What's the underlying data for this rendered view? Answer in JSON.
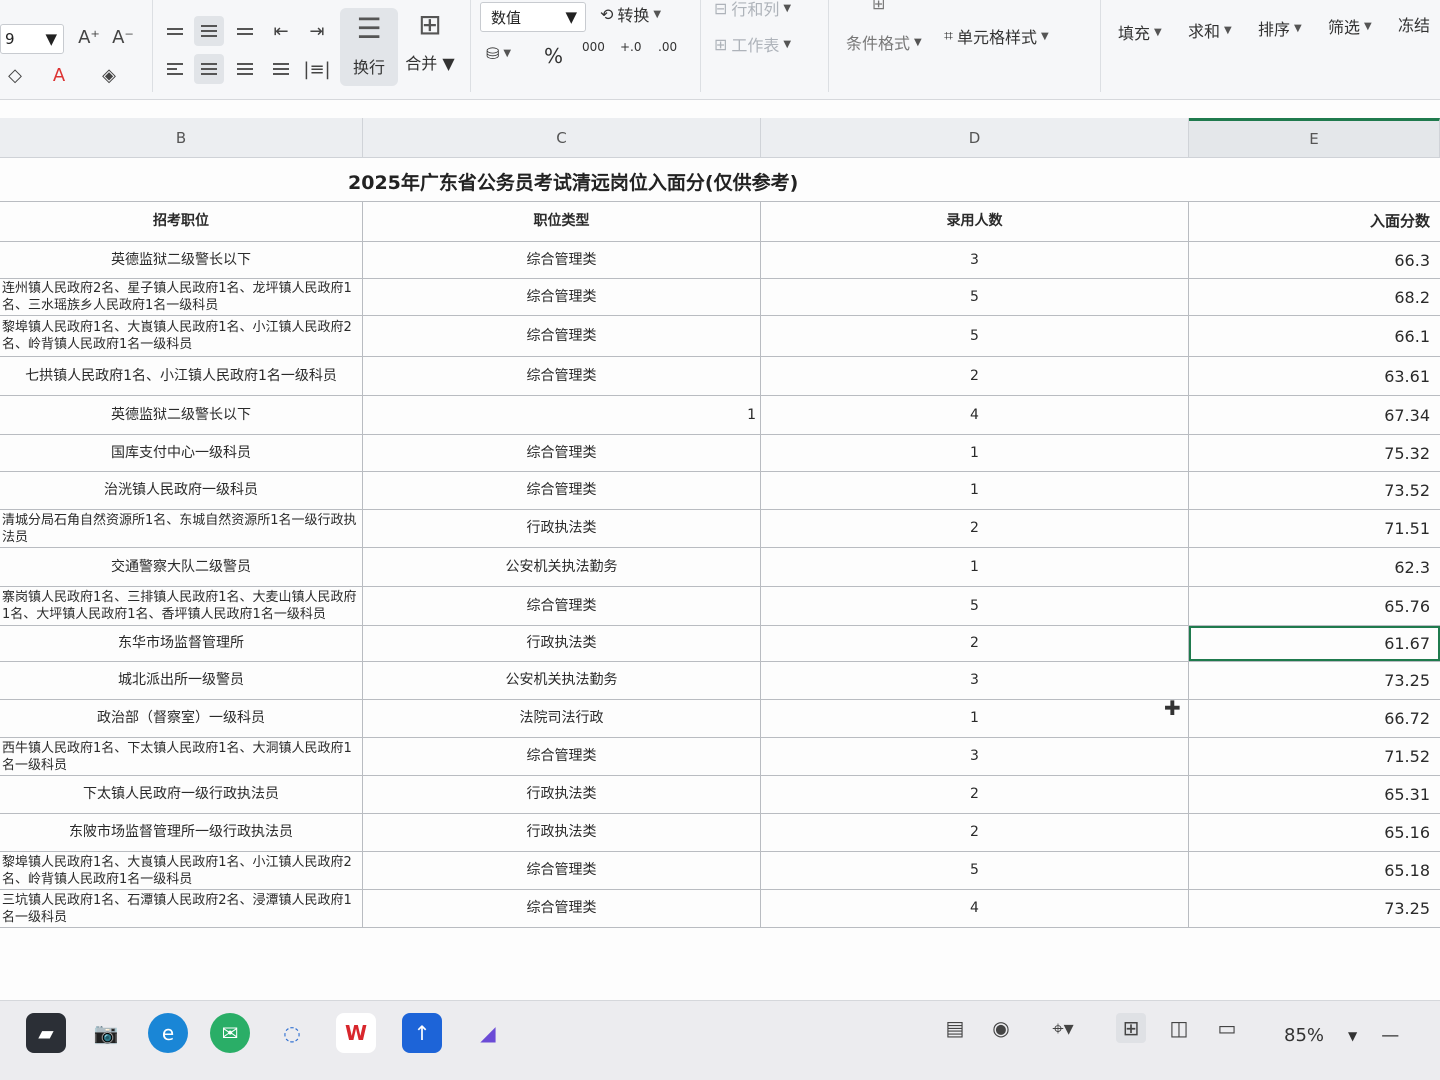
{
  "ribbon": {
    "font_size_value": "9",
    "number_format_value": "数值",
    "convert_label": "转换",
    "wrap_label": "换行",
    "merge_label": "合并",
    "row_col_label": "行和列",
    "worksheet_label": "工作表",
    "cond_format_label": "条件格式",
    "cell_style_label": "单元格样式",
    "fill_label": "填充",
    "sum_label": "求和",
    "sort_label": "排序",
    "filter_label": "筛选",
    "freeze_label": "冻结",
    "percent_symbol": "%",
    "thousands_symbol": "000",
    "inc_decimal_symbol": "+.0",
    "dec_decimal_symbol": ".00"
  },
  "columns": {
    "b": "B",
    "c": "C",
    "d": "D",
    "e": "E"
  },
  "sheet": {
    "title": "2025年广东省公务员考试清远岗位入面分(仅供参考)",
    "headers": {
      "position": "招考职位",
      "type": "职位类型",
      "count": "录用人数",
      "score": "入面分数"
    },
    "rows": [
      {
        "position": "英德监狱二级警长以下",
        "type": "综合管理类",
        "count": "3",
        "score": "66.3"
      },
      {
        "position": "连州镇人民政府2名、星子镇人民政府1名、龙坪镇人民政府1名、三水瑶族乡人民政府1名一级科员",
        "type": "综合管理类",
        "count": "5",
        "score": "68.2"
      },
      {
        "position": "黎埠镇人民政府1名、大崀镇人民政府1名、小江镇人民政府2名、岭背镇人民政府1名一级科员",
        "type": "综合管理类",
        "count": "5",
        "score": "66.1"
      },
      {
        "position": "七拱镇人民政府1名、小江镇人民政府1名一级科员",
        "type": "综合管理类",
        "count": "2",
        "score": "63.61"
      },
      {
        "position": "英德监狱二级警长以下",
        "type": "1",
        "count": "4",
        "score": "67.34"
      },
      {
        "position": "国库支付中心一级科员",
        "type": "综合管理类",
        "count": "1",
        "score": "75.32"
      },
      {
        "position": "治洸镇人民政府一级科员",
        "type": "综合管理类",
        "count": "1",
        "score": "73.52"
      },
      {
        "position": "清城分局石角自然资源所1名、东城自然资源所1名一级行政执法员",
        "type": "行政执法类",
        "count": "2",
        "score": "71.51"
      },
      {
        "position": "交通警察大队二级警员",
        "type": "公安机关执法勤务",
        "count": "1",
        "score": "62.3"
      },
      {
        "position": "寨岗镇人民政府1名、三排镇人民政府1名、大麦山镇人民政府1名、大坪镇人民政府1名、香坪镇人民政府1名一级科员",
        "type": "综合管理类",
        "count": "5",
        "score": "65.76"
      },
      {
        "position": "东华市场监督管理所",
        "type": "行政执法类",
        "count": "2",
        "score": "61.67"
      },
      {
        "position": "城北派出所一级警员",
        "type": "公安机关执法勤务",
        "count": "3",
        "score": "73.25"
      },
      {
        "position": "政治部（督察室）一级科员",
        "type": "法院司法行政",
        "count": "1",
        "score": "66.72"
      },
      {
        "position": "西牛镇人民政府1名、下太镇人民政府1名、大洞镇人民政府1名一级科员",
        "type": "综合管理类",
        "count": "3",
        "score": "71.52"
      },
      {
        "position": "下太镇人民政府一级行政执法员",
        "type": "行政执法类",
        "count": "2",
        "score": "65.31"
      },
      {
        "position": "东陂市场监督管理所一级行政执法员",
        "type": "行政执法类",
        "count": "2",
        "score": "65.16"
      },
      {
        "position": "黎埠镇人民政府1名、大崀镇人民政府1名、小江镇人民政府2名、岭背镇人民政府1名一级科员",
        "type": "综合管理类",
        "count": "5",
        "score": "65.18"
      },
      {
        "position": "三坑镇人民政府1名、石潭镇人民政府2名、浸潭镇人民政府1名一级科员",
        "type": "综合管理类",
        "count": "4",
        "score": "73.25"
      }
    ]
  },
  "status": {
    "zoom": "85%"
  },
  "colors": {
    "accent": "#1f7a4d",
    "wps_red": "#d8262c",
    "edge_blue": "#1a86d6",
    "wechat_green": "#2aae67"
  }
}
